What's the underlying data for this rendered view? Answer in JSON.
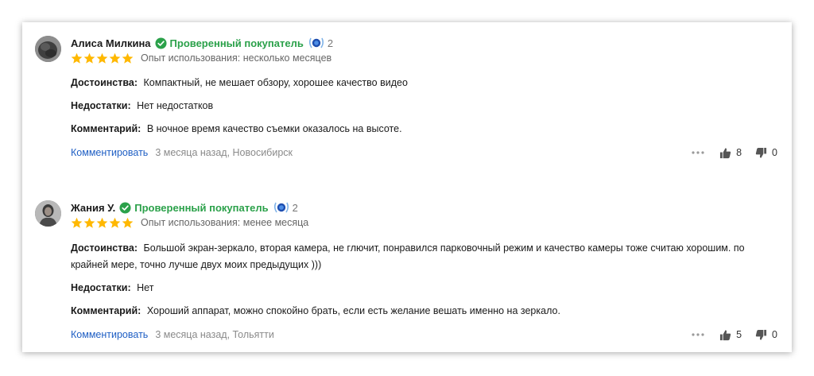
{
  "reviews": [
    {
      "author": "Алиса Милкина",
      "verified_label": "Проверенный покупатель",
      "badge_count": "2",
      "rating": 5,
      "experience": "Опыт использования: несколько месяцев",
      "pros_label": "Достоинства:",
      "pros": "Компактный, не мешает обзору, хорошее качество видео",
      "cons_label": "Недостатки:",
      "cons": "Нет недостатков",
      "comment_label": "Комментарий:",
      "comment": "В ночное время качество съемки оказалось на высоте.",
      "comment_link": "Комментировать",
      "meta": "3 месяца назад, Новосибирск",
      "likes": "8",
      "dislikes": "0"
    },
    {
      "author": "Жания У.",
      "verified_label": "Проверенный покупатель",
      "badge_count": "2",
      "rating": 5,
      "experience": "Опыт использования: менее месяца",
      "pros_label": "Достоинства:",
      "pros": "Большой экран-зеркало, вторая камера, не глючит, понравился парковочный режим и качество камеры тоже считаю хорошим. по крайней мере, точно лучше двух моих предыдущих )))",
      "cons_label": "Недостатки:",
      "cons": "Нет",
      "comment_label": "Комментарий:",
      "comment": "Хороший аппарат, можно спокойно брать, если есть желание вешать именно на зеркало.",
      "comment_link": "Комментировать",
      "meta": "3 месяца назад, Тольятти",
      "likes": "5",
      "dislikes": "0"
    }
  ],
  "colors": {
    "verified": "#2ba14a",
    "star": "#ffb800",
    "link": "#1f5fc4",
    "meta": "#8a8a8a"
  }
}
